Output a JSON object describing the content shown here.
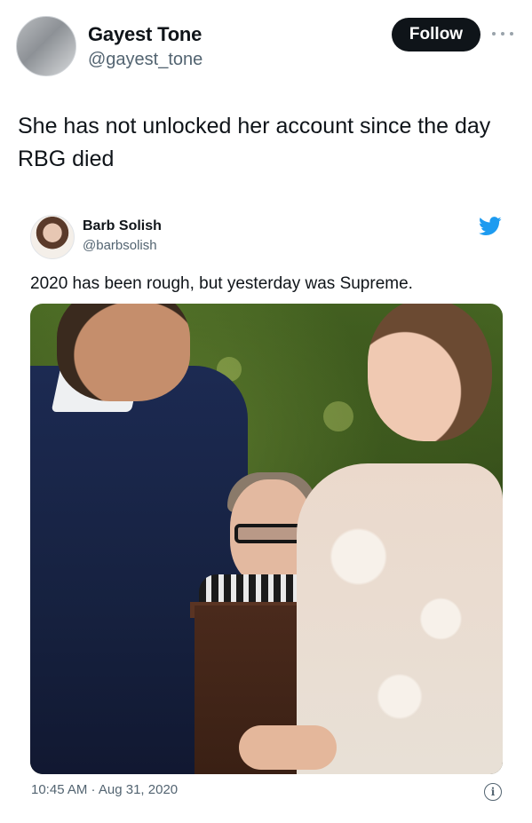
{
  "outer_tweet": {
    "author_name": "Gayest Tone",
    "author_handle": "@gayest_tone",
    "follow_label": "Follow",
    "text_lines": [
      "She has not unlocked her account since the day",
      "RBG died"
    ]
  },
  "embedded_tweet": {
    "author_name": "Barb Solish",
    "author_handle": "@barbsolish",
    "text": "2020 has been rough, but yesterday was Supreme.",
    "timestamp": "10:45 AM · Aug 31, 2020",
    "logo_icon": "twitter-bird-icon",
    "info_icon": "info-icon",
    "info_glyph": "i"
  },
  "colors": {
    "follow_button_bg": "#0f1419",
    "twitter_blue": "#1d9bf0",
    "secondary_text": "#536471"
  }
}
